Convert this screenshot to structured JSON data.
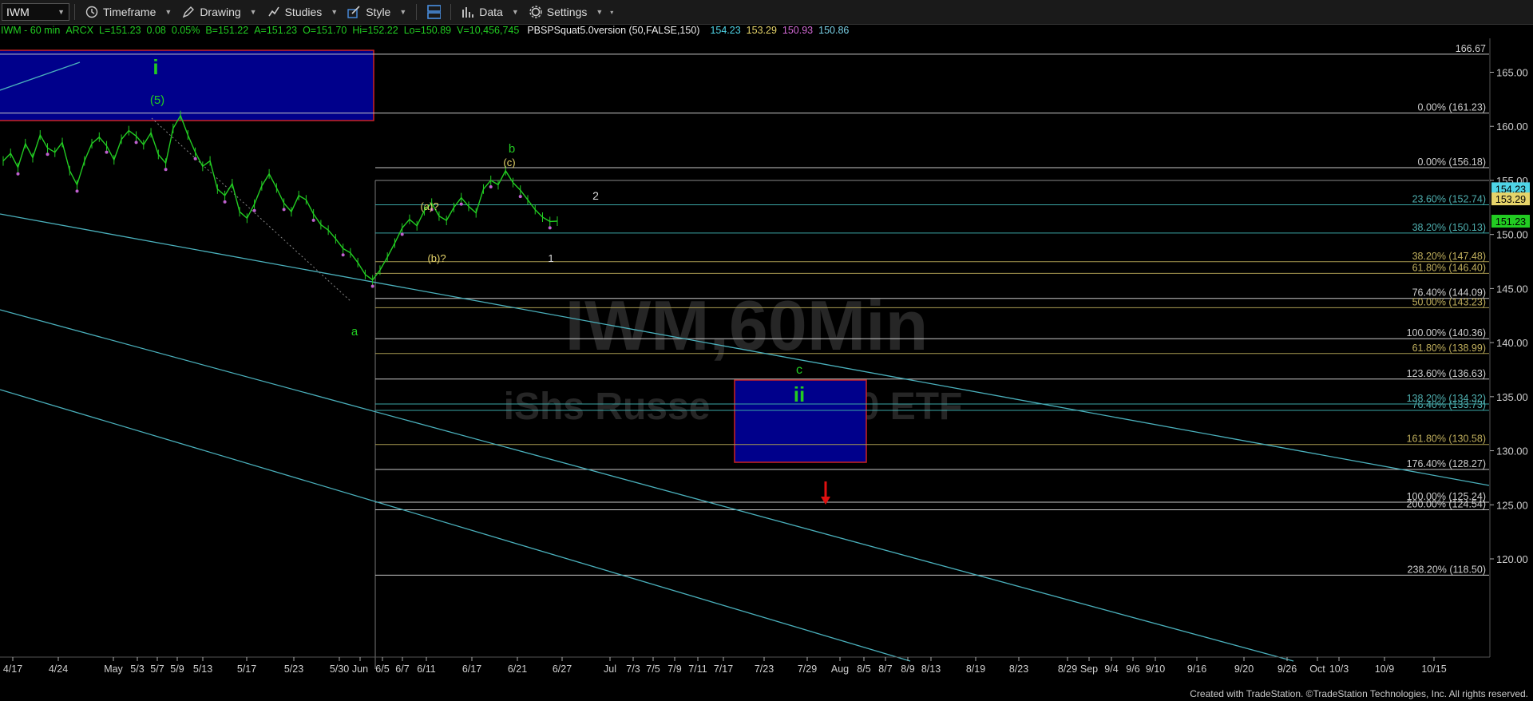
{
  "toolbar": {
    "symbol": "IWM",
    "timeframe": "Timeframe",
    "drawing": "Drawing",
    "studies": "Studies",
    "style": "Style",
    "data": "Data",
    "settings": "Settings"
  },
  "info": {
    "title": "IWM - 60 min",
    "exchange": "ARCX",
    "last": "L=151.23",
    "change": "0.08",
    "pct": "0.05%",
    "bid": "B=151.22",
    "ask": "A=151.23",
    "open": "O=151.70",
    "high": "Hi=152.22",
    "low": "Lo=150.89",
    "volume": "V=10,456,745",
    "study": "PBSPSquat5.0version (50,FALSE,150)",
    "study_values": [
      "154.23",
      "153.29",
      "150.93",
      "150.86"
    ],
    "study_colors": [
      "#4fd4e6",
      "#e6d46a",
      "#d36ad6",
      "#7ad0e6"
    ]
  },
  "watermark": {
    "line1": "IWM,60Min",
    "line2": "iShs Russe",
    "line3": "0 ETF"
  },
  "footer": "Created with TradeStation. ©TradeStation Technologies, Inc. All rights reserved.",
  "chart_data": {
    "type": "line",
    "title": "IWM - 60 min",
    "y_axis": {
      "ylim": [
        116.5,
        168.5
      ],
      "ticks": [
        "165.00",
        "160.00",
        "155.00",
        "150.00",
        "145.00",
        "140.00",
        "135.00",
        "130.00",
        "125.00",
        "120.00"
      ]
    },
    "x_ticks": [
      "4/17",
      "4/24",
      "May",
      "5/3",
      "5/7",
      "5/9",
      "5/13",
      "5/17",
      "5/23",
      "5/30",
      "Jun",
      "6/5",
      "6/7",
      "6/11",
      "6/17",
      "6/21",
      "6/27",
      "Jul",
      "7/3",
      "7/5",
      "7/9",
      "7/11",
      "7/17",
      "7/23",
      "7/29",
      "Aug",
      "8/5",
      "8/7",
      "8/9",
      "8/13",
      "8/19",
      "8/23",
      "8/29",
      "Sep",
      "9/4",
      "9/6",
      "9/10",
      "9/16",
      "9/20",
      "9/26",
      "Oct",
      "10/3",
      "10/9",
      "10/15"
    ],
    "price_axis_badges": [
      {
        "value": 154.23,
        "label": "154.23",
        "color": "#4fd4e6"
      },
      {
        "value": 153.29,
        "label": "153.29",
        "color": "#e6d46a"
      },
      {
        "value": 151.23,
        "label": "151.23",
        "color": "#22cc22"
      }
    ],
    "fib_levels": [
      {
        "value": 166.67,
        "label": "166.67",
        "color": "#c8c8c8"
      },
      {
        "value": 161.23,
        "label": "0.00% (161.23)",
        "color": "#c8c8c8"
      },
      {
        "value": 156.18,
        "label": "0.00% (156.18)",
        "color": "#c8c8c8"
      },
      {
        "value": 152.74,
        "label": "23.60% (152.74)",
        "color": "#3aa6a6"
      },
      {
        "value": 150.13,
        "label": "38.20% (150.13)",
        "color": "#3aa6a6"
      },
      {
        "value": 147.48,
        "label": "38.20% (147.48)",
        "color": "#a89a50"
      },
      {
        "value": 146.4,
        "label": "61.80% (146.40)",
        "color": "#a89a50"
      },
      {
        "value": 144.09,
        "label": "76.40% (144.09)",
        "color": "#c8c8c8"
      },
      {
        "value": 143.23,
        "label": "50.00% (143.23)",
        "color": "#a89a50"
      },
      {
        "value": 140.36,
        "label": "100.00% (140.36)",
        "color": "#c8c8c8"
      },
      {
        "value": 138.99,
        "label": "61.80% (138.99)",
        "color": "#a89a50"
      },
      {
        "value": 136.63,
        "label": "123.60% (136.63)",
        "color": "#c8c8c8"
      },
      {
        "value": 134.32,
        "label": "138.20% (134.32)",
        "color": "#3aa6a6"
      },
      {
        "value": 133.73,
        "label": "76.40% (133.73)",
        "color": "#3aa6a6"
      },
      {
        "value": 130.58,
        "label": "161.80% (130.58)",
        "color": "#a89a50"
      },
      {
        "value": 128.27,
        "label": "176.40% (128.27)",
        "color": "#c8c8c8"
      },
      {
        "value": 125.24,
        "label": "100.00% (125.24)",
        "color": "#c8c8c8"
      },
      {
        "value": 124.54,
        "label": "200.00% (124.54)",
        "color": "#c8c8c8"
      },
      {
        "value": 118.5,
        "label": "238.20% (118.50)",
        "color": "#c8c8c8"
      }
    ],
    "wave_labels": [
      {
        "text": "i",
        "color": "#22cc22"
      },
      {
        "text": "(5)",
        "color": "#22cc22"
      },
      {
        "text": "a",
        "color": "#22cc22"
      },
      {
        "text": "b",
        "color": "#22cc22"
      },
      {
        "text": "(c)",
        "color": "#e6d46a"
      },
      {
        "text": "(a)?",
        "color": "#e6d46a"
      },
      {
        "text": "(b)?",
        "color": "#e6d46a"
      },
      {
        "text": "2",
        "color": "#dddddd"
      },
      {
        "text": "1",
        "color": "#dddddd"
      },
      {
        "text": "c",
        "color": "#22cc22"
      },
      {
        "text": "ii",
        "color": "#22cc22"
      }
    ],
    "price_series": [
      156.8,
      157.5,
      156.2,
      158.4,
      157.1,
      159.2,
      158.0,
      157.6,
      158.5,
      155.9,
      154.6,
      156.8,
      158.4,
      159.0,
      158.2,
      156.9,
      158.8,
      159.6,
      159.1,
      158.3,
      159.4,
      157.4,
      156.6,
      159.8,
      161.0,
      159.2,
      157.6,
      156.3,
      156.8,
      154.2,
      153.6,
      154.7,
      152.1,
      151.5,
      152.8,
      154.5,
      155.6,
      154.3,
      152.9,
      152.1,
      153.6,
      153.2,
      151.9,
      150.9,
      150.4,
      149.6,
      148.7,
      148.3,
      147.4,
      146.3,
      145.8,
      146.7,
      147.9,
      149.2,
      150.6,
      151.4,
      150.8,
      152.2,
      152.9,
      151.7,
      151.3,
      152.5,
      153.4,
      152.6,
      152.0,
      154.2,
      155.0,
      154.6,
      155.9,
      154.8,
      154.1,
      153.2,
      152.3,
      151.6,
      151.2,
      151.23
    ]
  }
}
